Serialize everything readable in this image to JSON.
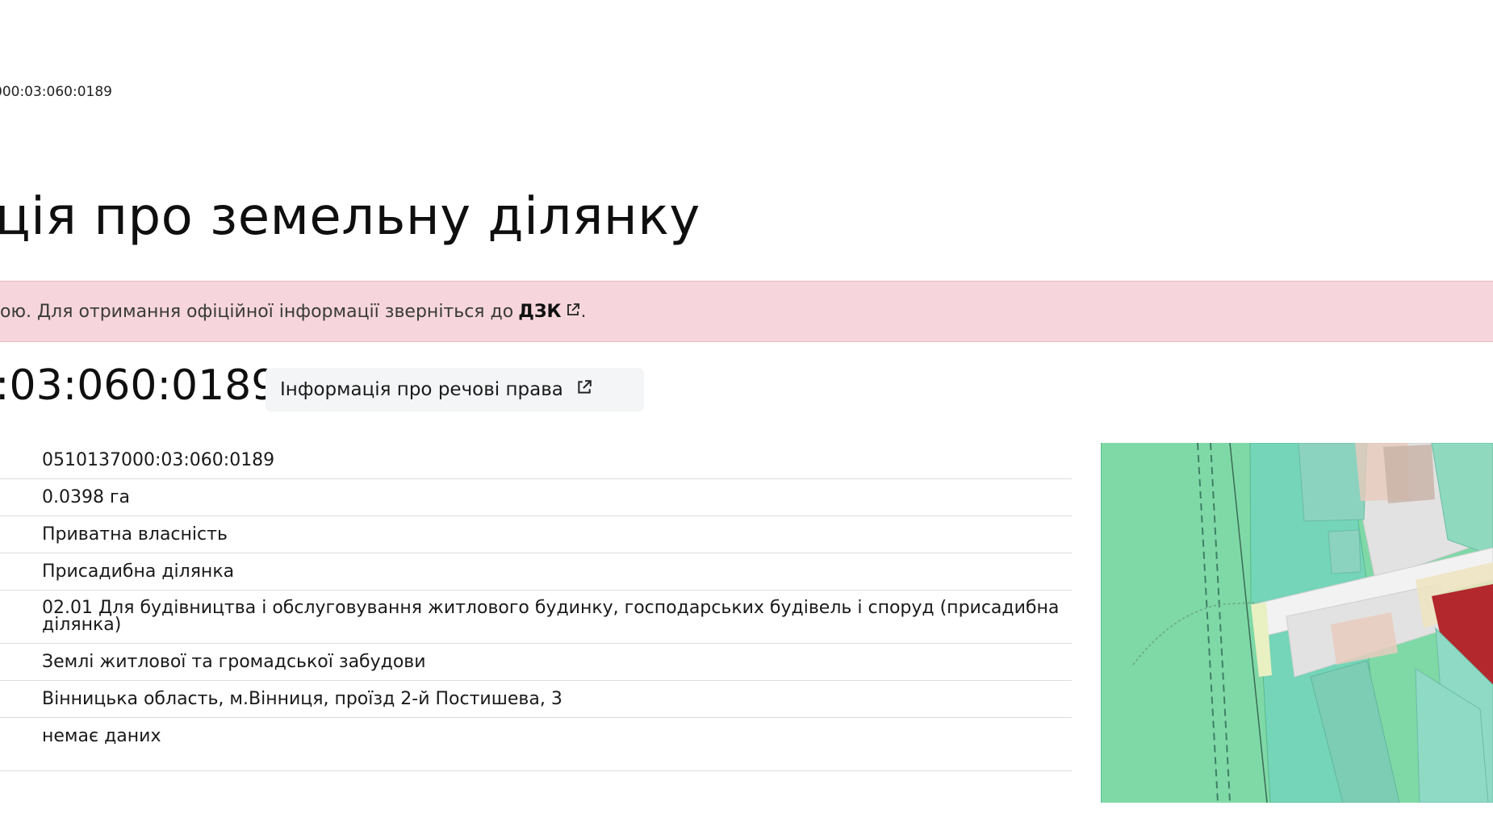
{
  "breadcrumb": "000:03:060:0189",
  "page_title": "ція про земельну ділянку",
  "alert": {
    "text": "ою. Для отримання офіційної інформації зверніться до",
    "link": "ДЗК",
    "suffix": "."
  },
  "parcel": {
    "cadastral_heading": ":03:060:0189",
    "rights_button": "Інформація про речові права"
  },
  "details": [
    "0510137000:03:060:0189",
    "0.0398 га",
    "Приватна власність",
    "Присадибна ділянка",
    "02.01 Для будівництва і обслуговування житлового будинку, господарських будівель і споруд (присадибна ділянка)",
    "Землі житлової та громадської забудови",
    "Вінницька область, м.Вінниця, проїзд 2-й Постишева, 3",
    "немає даних"
  ],
  "colors": {
    "alert_bg": "#f6d6dc",
    "map_green": "#7fd9a6",
    "map_teal": "#74d5b8",
    "map_gray": "#e2e2e2",
    "parcel_red": "#b3282d"
  },
  "icons": [
    "external-link-icon"
  ]
}
